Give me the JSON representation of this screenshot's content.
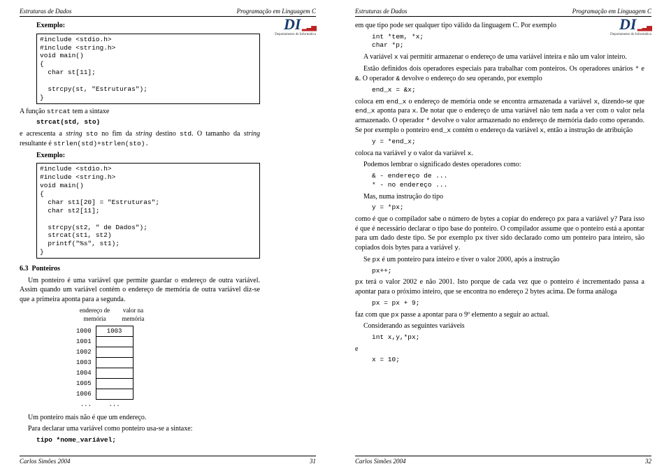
{
  "header": {
    "left": "Estruturas de Dados",
    "right": "Programação em Linguagem C"
  },
  "logo": {
    "di": "DI",
    "dept": "Departamento de Informática"
  },
  "left": {
    "exemplo_label": "Exemplo:",
    "code1": "#include <stdio.h>\n#include <string.h>\nvoid main()\n{\n  char st[11];\n\n  strcpy(st, \"Estruturas\");\n}",
    "p1a": "A função ",
    "p1b": " tem a sintaxe",
    "strcat_fn": "strcat",
    "sig": "strcat(std, sto)",
    "p2a": "e acrescenta a ",
    "p2b": "string ",
    "p2c": "sto",
    "p2d": " no fim da ",
    "p2e": "string",
    "p2f": " destino ",
    "p2g": "std",
    "p2h": ". O tamanho da ",
    "p2i": "string",
    "p2j": " resultante é ",
    "p2k": "strlen(std)+strlen(sto).",
    "code2": "#include <stdio.h>\n#include <string.h>\nvoid main()\n{\n  char st1[20] = \"Estruturas\";\n  char st2[11];\n\n  strcpy(st2, \" de Dados\");\n  strcat(st1, st2)\n  printf(\"%s\", st1);\n}",
    "sec_num": "6.3",
    "sec_title": "Ponteiros",
    "p3": "Um ponteiro é uma variável que permite guardar o endereço de outra variável. Assim quando um variável contém o endereço de memória de outra variável diz-se que a primeira aponta para a segunda.",
    "mem": {
      "h1": "endereço de\nmemória",
      "h2": "valor na\nmemória",
      "addrs": [
        "1000",
        "1001",
        "1002",
        "1003",
        "1004",
        "1005",
        "1006",
        "..."
      ],
      "vals": [
        "1003",
        "",
        "",
        "",
        "",
        "",
        "",
        "..."
      ]
    },
    "p4": "Um ponteiro mais não é que um endereço.",
    "p5": "Para declarar uma variável como ponteiro usa-se a sintaxe:",
    "decl": "tipo *nome_variável;"
  },
  "right": {
    "p1": "em que tipo pode ser qualquer tipo válido da linguagem C. Por exemplo",
    "code1": "int *tem, *x;\nchar *p;",
    "p2a": "A variável ",
    "p2b": "x",
    "p2c": " vai permitir armazenar o endereço de uma variável inteira e não um valor inteiro.",
    "p3a": "Estão definidos dois operadores especiais para trabalhar com ponteiros. Os operadores unários ",
    "p3b": "*",
    "p3c": " e ",
    "p3d": "&",
    "p3e": ". O operador ",
    "p3f": "&",
    "p3g": " devolve o endereço do seu operando, por exemplo",
    "code2": "end_x = &x;",
    "p4a": "coloca em ",
    "p4b": "end_x",
    "p4c": " o endereço de memória onde se encontra armazenada a variável ",
    "p4d": "x",
    "p4e": ", dizendo-se que ",
    "p4f": "end_x",
    "p4g": " aponta para ",
    "p4h": "x",
    "p4i": ". De notar que o endereço de uma variável não tem nada a ver com o valor nela armazenado. O operador ",
    "p4j": "*",
    "p4k": " devolve o valor armazenado no endereço de memória dado como operando. Se por exemplo o ponteiro ",
    "p4l": "end_x",
    "p4m": " contém o endereço da variável ",
    "p4n": "x",
    "p4o": ", então a instrução de atribuição",
    "code3": "y = *end_x;",
    "p5a": "coloca na variável ",
    "p5b": "y",
    "p5c": " o valor da variável ",
    "p5d": "x",
    "p5e": ".",
    "p6": "Podemos lembrar o significado destes operadores como:",
    "bul1": "& - endereço de ...",
    "bul2": "* - no endereço ...",
    "p7": "Mas, numa instrução do tipo",
    "code4": "y = *px;",
    "p8a": "como é que o compilador sabe o número de bytes a copiar do endereço ",
    "p8b": "px",
    "p8c": " para a variável ",
    "p8d": "y",
    "p8e": "? Para isso é que é necessário declarar o tipo base do ponteiro. O compilador assume que o ponteiro está a apontar para um dado deste tipo. Se por exemplo ",
    "p8f": "px",
    "p8g": " tiver sido declarado como um ponteiro para inteiro, são copiados dois bytes para a variável ",
    "p8h": "y",
    "p8i": ".",
    "p9a": "Se ",
    "p9b": "px",
    "p9c": " é um ponteiro para inteiro e tiver o valor 2000, após a instrução",
    "code5": "px++;",
    "p10a": "px",
    "p10b": " terá o valor 2002 e não 2001. Isto porque de cada vez que o ponteiro é incrementado passa a apontar para o próximo inteiro, que se encontra no endereço 2 bytes acima. De forma análoga",
    "code6": "px = px + 9;",
    "p11a": "faz com que ",
    "p11b": "px",
    "p11c": " passe a apontar para o 9º elemento a seguir ao actual.",
    "p12": "Considerando as seguintes variáveis",
    "code7": "int x,y,*px;",
    "p13": "e",
    "code8": "x = 10;"
  },
  "footer": {
    "author": "Carlos Simões 2004",
    "pL": "31",
    "pR": "32"
  }
}
